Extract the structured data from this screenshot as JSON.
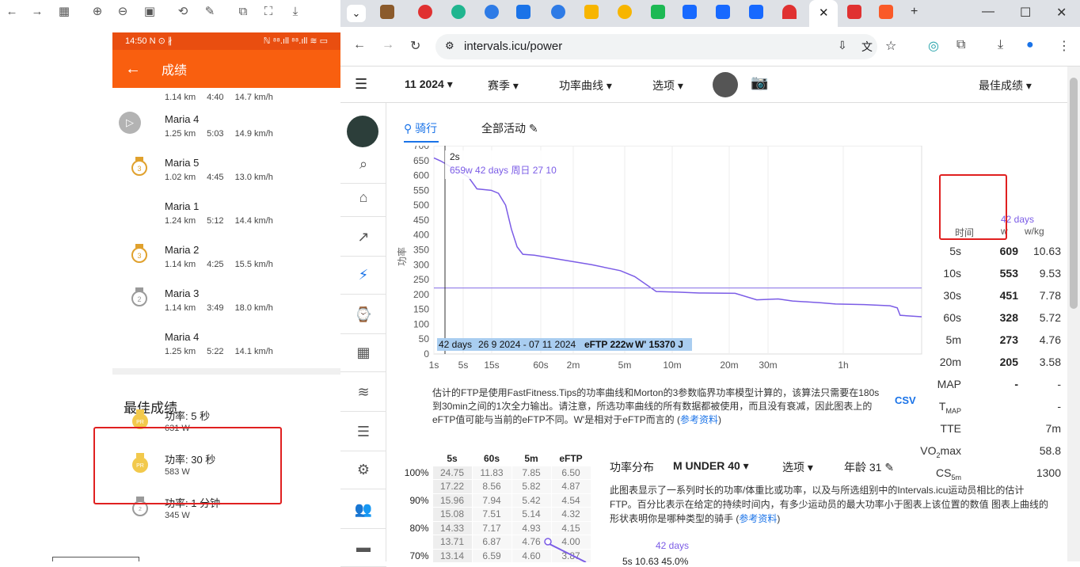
{
  "left_toolbar": {
    "icons": [
      "back-arrow-icon",
      "forward-arrow-icon",
      "grid-icon",
      "zoom-in-icon",
      "zoom-out-icon",
      "fit-icon",
      "rotate-icon",
      "edit-icon",
      "screenshot-icon",
      "crop-icon",
      "download-icon"
    ]
  },
  "phone": {
    "status_time": "14:50",
    "status_icons": "N ⊙ ∦",
    "status_right": "ℕ ⁸⁸.ıll ⁸⁸.ıll ≋ ▭",
    "title": "成绩",
    "activities": [
      {
        "name": "",
        "dist": "1.14 km",
        "time": "4:40",
        "speed": "14.7 km/h",
        "medal": "none"
      },
      {
        "name": "Maria 4",
        "dist": "1.25 km",
        "time": "5:03",
        "speed": "14.9 km/h",
        "medal": "play"
      },
      {
        "name": "Maria 5",
        "dist": "1.02 km",
        "time": "4:45",
        "speed": "13.0 km/h",
        "medal": "bronze",
        "rank": "3"
      },
      {
        "name": "Maria 1",
        "dist": "1.24 km",
        "time": "5:12",
        "speed": "14.4 km/h",
        "medal": "none"
      },
      {
        "name": "Maria 2",
        "dist": "1.14 km",
        "time": "4:25",
        "speed": "15.5 km/h",
        "medal": "bronze",
        "rank": "3"
      },
      {
        "name": "Maria 3",
        "dist": "1.14 km",
        "time": "3:49",
        "speed": "18.0 km/h",
        "medal": "silver",
        "rank": "2"
      },
      {
        "name": "Maria 4",
        "dist": "1.25 km",
        "time": "5:22",
        "speed": "14.1 km/h",
        "medal": "none"
      }
    ],
    "best_header": "最佳成绩",
    "best": [
      {
        "name": "功率: 5 秒",
        "value": "631 W",
        "medal": "gold",
        "rank": "PR"
      },
      {
        "name": "功率: 30 秒",
        "value": "583 W",
        "medal": "gold",
        "rank": "PR"
      },
      {
        "name": "功率: 1 分钟",
        "value": "345 W",
        "medal": "silver",
        "rank": "2"
      }
    ]
  },
  "browser": {
    "url": "intervals.icu/power",
    "nav": {
      "back": "←",
      "forward": "→",
      "reload": "↻"
    }
  },
  "site": {
    "header": {
      "date": "11 2024",
      "season": "赛季",
      "curve": "功率曲线",
      "options": "选项",
      "best": "最佳成绩"
    },
    "tabs": {
      "ride": "骑行",
      "all": "全部活动"
    },
    "chart": {
      "tooltip_dur": "2s",
      "tooltip_line": "659w  42 days  周日 27 10",
      "ylabel": "功率",
      "footer": [
        "42 days",
        "26 9 2024 - 07 11 2024",
        "eFTP 222w",
        "W' 15370 J"
      ],
      "xticks": [
        "1s",
        "5s",
        "15s",
        "60s",
        "2m",
        "5m",
        "10m",
        "20m",
        "30m",
        "1h"
      ],
      "yticks": [
        "700",
        "650",
        "600",
        "550",
        "500",
        "450",
        "400",
        "350",
        "300",
        "250",
        "200",
        "150",
        "100",
        "50",
        "0"
      ],
      "description": "估计的FTP是使用FastFitness.Tips的功率曲线和Morton的3参数临界功率模型计算的，该算法只需要在180s到30min之间的1次全力输出。请注意，所选功率曲线的所有数据都被使用，而且没有衰减，因此图表上的eFTP值可能与当前的eFTP不同。W'是相对于eFTP而言的 (",
      "ref": "参考资料",
      "close": ")",
      "csv": "CSV"
    },
    "best_table": {
      "period": "42 days",
      "h_time": "时间",
      "h_w": "w",
      "h_wkg": "w/kg",
      "rows": [
        {
          "t": "5s",
          "w": "609",
          "wkg": "10.63"
        },
        {
          "t": "10s",
          "w": "553",
          "wkg": "9.53"
        },
        {
          "t": "30s",
          "w": "451",
          "wkg": "7.78"
        },
        {
          "t": "60s",
          "w": "328",
          "wkg": "5.72"
        },
        {
          "t": "5m",
          "w": "273",
          "wkg": "4.76"
        },
        {
          "t": "20m",
          "w": "205",
          "wkg": "3.58"
        },
        {
          "t": "MAP",
          "w": "-",
          "wkg": "-"
        },
        {
          "t": "TMAP",
          "w": "",
          "wkg": "-"
        },
        {
          "t": "TTE",
          "w": "",
          "wkg": "7m"
        },
        {
          "t": "VO2max",
          "w": "",
          "wkg": "58.8"
        },
        {
          "t": "CS5m",
          "w": "",
          "wkg": "1300"
        }
      ]
    },
    "dist": {
      "title": "功率分布",
      "group": "M UNDER 40",
      "options": "选项",
      "age": "年龄 31",
      "text": "此图表显示了一系列时长的功率/体重比或功率，以及与所选组别中的Intervals.icu运动员相比的估计FTP。百分比表示在给定的持续时间内，有多少运动员的最大功率小于图表上该位置的数值 图表上曲线的形状表明你是哪种类型的骑手 (",
      "ref": "参考资料",
      "close": ")",
      "period": "42 days",
      "row_sel": "5s  10.63  45.0%",
      "cols": [
        "5s",
        "60s",
        "5m",
        "eFTP"
      ],
      "rows": [
        [
          "100%",
          "24.75",
          "11.83",
          "7.85",
          "6.50"
        ],
        [
          "",
          "17.22",
          "8.56",
          "5.82",
          "4.87"
        ],
        [
          "90%",
          "15.96",
          "7.94",
          "5.42",
          "4.54"
        ],
        [
          "",
          "15.08",
          "7.51",
          "5.14",
          "4.32"
        ],
        [
          "80%",
          "14.33",
          "7.17",
          "4.93",
          "4.15"
        ],
        [
          "",
          "13.71",
          "6.87",
          "4.76",
          "4.00"
        ],
        [
          "70%",
          "13.14",
          "6.59",
          "4.60",
          "3.87"
        ]
      ]
    }
  },
  "colors": {
    "orange": "#f95f0f",
    "purple": "#7b5ce6",
    "red_box": "#e02020",
    "active_blue": "#1a73e8"
  }
}
